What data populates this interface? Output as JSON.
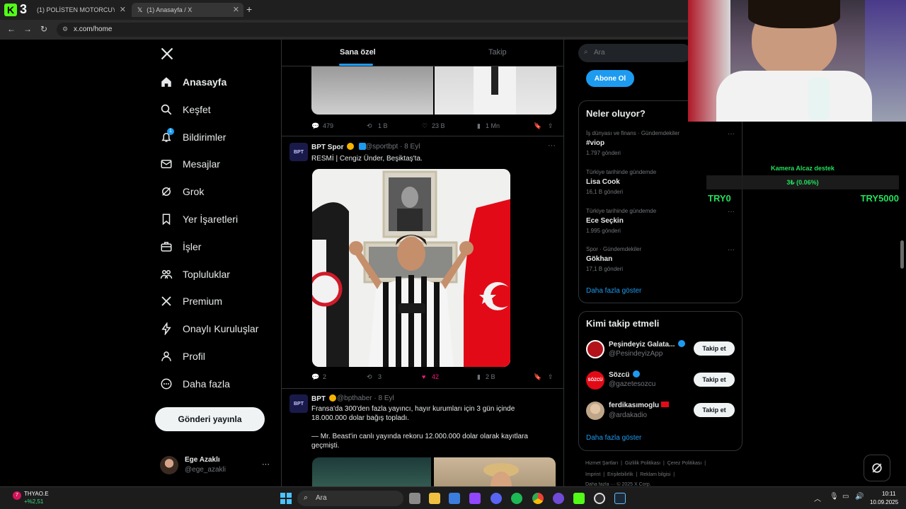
{
  "browser": {
    "tabs": [
      {
        "title": "(1) POLİSTEN MOTORCUYA UYA",
        "active": false
      },
      {
        "title": "(1) Anasayfa / X",
        "active": true
      }
    ],
    "url": "x.com/home",
    "brand_badge": "3"
  },
  "nav": {
    "items": [
      {
        "label": "Anasayfa",
        "icon": "home-icon"
      },
      {
        "label": "Keşfet",
        "icon": "search-icon"
      },
      {
        "label": "Bildirimler",
        "icon": "bell-icon",
        "badge": "1"
      },
      {
        "label": "Mesajlar",
        "icon": "mail-icon"
      },
      {
        "label": "Grok",
        "icon": "grok-icon"
      },
      {
        "label": "Yer İşaretleri",
        "icon": "bookmark-icon"
      },
      {
        "label": "İşler",
        "icon": "briefcase-icon"
      },
      {
        "label": "Topluluklar",
        "icon": "people-icon"
      },
      {
        "label": "Premium",
        "icon": "x-logo-icon"
      },
      {
        "label": "Onaylı Kuruluşlar",
        "icon": "lightning-icon"
      },
      {
        "label": "Profil",
        "icon": "person-icon"
      },
      {
        "label": "Daha fazla",
        "icon": "more-circle-icon"
      }
    ],
    "post_button": "Gönderi yayınla",
    "account": {
      "name": "Ege Azaklı",
      "handle": "@ege_azakli",
      "more": "···"
    }
  },
  "feed": {
    "tabs": [
      {
        "label": "Sana özel",
        "active": true
      },
      {
        "label": "Takip",
        "active": false
      }
    ],
    "first_actions": {
      "replies": "479",
      "reposts": "1 B",
      "likes": "23 B",
      "views": "1 Mn"
    },
    "tweets": [
      {
        "name": "BPT Spor",
        "handle": "@sportbpt",
        "date": "· 8 Eyl",
        "avatar_text": "BPT",
        "text": "RESMİ | Cengiz Ünder, Beşiktaş'ta.",
        "actions": {
          "replies": "2",
          "reposts": "3",
          "likes": "42",
          "views": "2 B"
        }
      },
      {
        "name": "BPT",
        "handle": "@bpthaber",
        "date": "· 8 Eyl",
        "avatar_text": "BPT",
        "text1": "Fransa'da 300'den fazla yayıncı, hayır kurumları için 3 gün içinde",
        "text2": "18.000.000 dolar bağış topladı.",
        "text3": "— Mr. Beast'in canlı yayında rekoru 12.000.000 dolar olarak kayıtlara",
        "text4": "geçmişti."
      }
    ]
  },
  "right": {
    "search_placeholder": "Ara",
    "subscribe": "Abone Ol",
    "trends": {
      "title": "Neler oluyor?",
      "items": [
        {
          "category": "İş dünyası ve finans · Gündemdekiler",
          "name": "#viop",
          "count": "1.797 gönderi"
        },
        {
          "category": "Türkiye tarihinde gündemde",
          "name": "Lisa Cook",
          "count": "16,1 B gönderi"
        },
        {
          "category": "Türkiye tarihinde gündemde",
          "name": "Ece Seçkin",
          "count": "1.995 gönderi"
        },
        {
          "category": "Spor · Gündemdekiler",
          "name": "Gökhan",
          "count": "17,1 B gönderi"
        }
      ],
      "show_more": "Daha fazla göster"
    },
    "who_to_follow": {
      "title": "Kimi takip etmeli",
      "items": [
        {
          "name": "Peşindeyiz Galata...",
          "handle": "@PesindeyizApp",
          "button": "Takip et"
        },
        {
          "name": "Sözcü",
          "handle": "@gazetesozcu",
          "button": "Takip et",
          "avatar_text": "SÖZCÜ"
        },
        {
          "name": "ferdikasımoglu",
          "handle": "@ardakadio",
          "button": "Takip et"
        }
      ],
      "show_more": "Daha fazla göster"
    },
    "footer": {
      "row1": [
        "Hizmet Şartları",
        "Gizlilik Politikası",
        "Çerez Politikası"
      ],
      "row2": [
        "Imprint",
        "Erişilebilirlik",
        "Reklam bilgisi"
      ],
      "row3": "Daha fazla ···   © 2025 X Corp."
    }
  },
  "overlay": {
    "donation_title": "Kamera Alcaz destek",
    "donation_value": "3₺ (0.06%)",
    "goal_min": "TRY0",
    "goal_max": "TRY5000"
  },
  "taskbar": {
    "stock": {
      "symbol": "THYAO.E",
      "change": "+%2,51"
    },
    "search": "Ara",
    "time": "10:11",
    "date": "10.09.2025"
  },
  "colors": {
    "accent": "#1d9bf0",
    "like": "#f91880",
    "goal_green": "#22e05a"
  }
}
